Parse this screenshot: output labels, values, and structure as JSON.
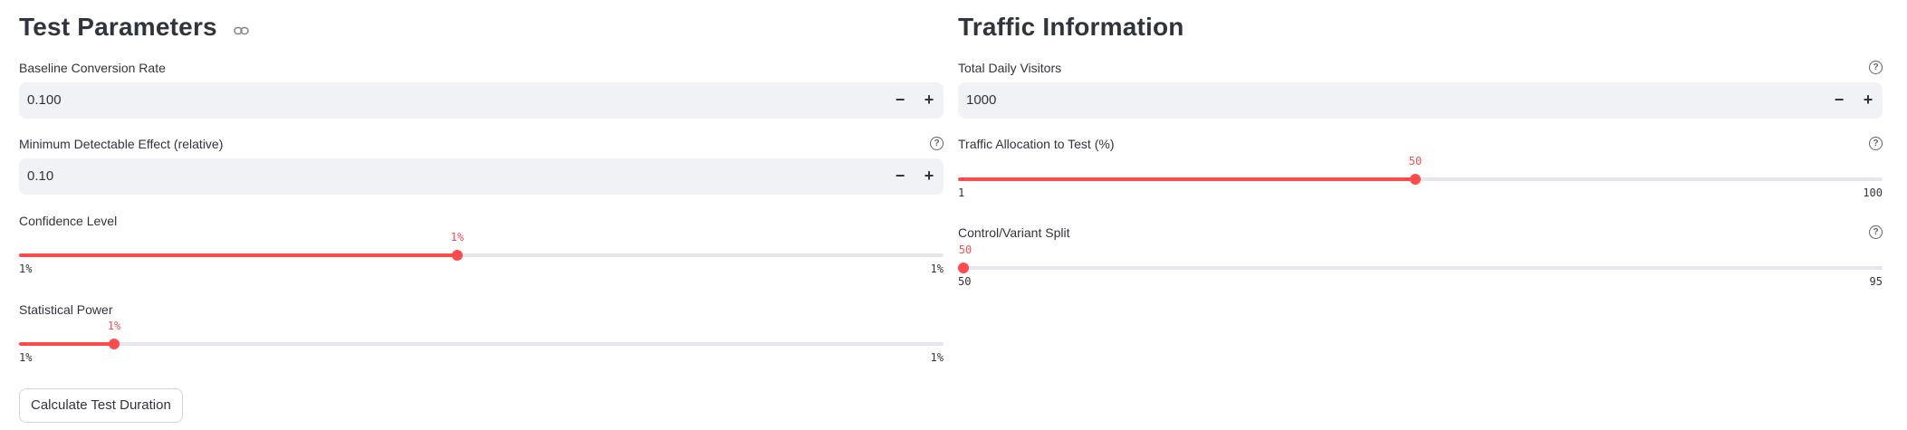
{
  "test_parameters": {
    "heading": "Test Parameters",
    "baseline": {
      "label": "Baseline Conversion Rate",
      "value": "0.100",
      "minus": "−",
      "plus": "+"
    },
    "mde": {
      "label": "Minimum Detectable Effect (relative)",
      "value": "0.10",
      "minus": "−",
      "plus": "+",
      "help": "?"
    },
    "confidence": {
      "label": "Confidence Level",
      "value_label": "1%",
      "min_label": "1%",
      "max_label": "1%",
      "position": 0.474
    },
    "power": {
      "label": "Statistical Power",
      "value_label": "1%",
      "min_label": "1%",
      "max_label": "1%",
      "position": 0.103
    },
    "calculate_button": "Calculate Test Duration"
  },
  "traffic_information": {
    "heading": "Traffic Information",
    "daily_visitors": {
      "label": "Total Daily Visitors",
      "value": "1000",
      "minus": "−",
      "plus": "+",
      "help": "?"
    },
    "allocation": {
      "label": "Traffic Allocation to Test (%)",
      "value": "50",
      "min": "1",
      "max": "100",
      "help": "?",
      "position": 0.495
    },
    "split": {
      "label": "Control/Variant Split",
      "value": "50",
      "min": "50",
      "max": "95",
      "help": "?",
      "position": 0.0
    }
  },
  "colors": {
    "accent": "#ff4b4b",
    "input_bg": "#f0f2f6",
    "track": "#e5e7ec",
    "text": "#31333f"
  }
}
